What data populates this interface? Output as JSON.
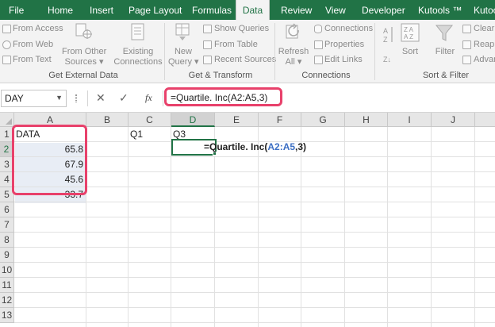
{
  "ribbon_tabs": [
    {
      "label": "File",
      "active": false
    },
    {
      "label": "Home",
      "active": false
    },
    {
      "label": "Insert",
      "active": false
    },
    {
      "label": "Page Layout",
      "active": false
    },
    {
      "label": "Formulas",
      "active": false
    },
    {
      "label": "Data",
      "active": true
    },
    {
      "label": "Review",
      "active": false
    },
    {
      "label": "View",
      "active": false
    },
    {
      "label": "Developer",
      "active": false
    },
    {
      "label": "Kutools ™",
      "active": false
    },
    {
      "label": "Kutoo",
      "active": false
    }
  ],
  "ribbon": {
    "get_external_data": {
      "from_access": "From Access",
      "from_web": "From Web",
      "from_text": "From Text",
      "from_other_sources_line1": "From Other",
      "from_other_sources_line2": "Sources ▾",
      "existing_connections_line1": "Existing",
      "existing_connections_line2": "Connections",
      "group_label": "Get External Data"
    },
    "get_transform": {
      "new_query_line1": "New",
      "new_query_line2": "Query ▾",
      "show_queries": "Show Queries",
      "from_table": "From Table",
      "recent_sources": "Recent Sources",
      "group_label": "Get & Transform"
    },
    "connections": {
      "refresh_all_line1": "Refresh",
      "refresh_all_line2": "All ▾",
      "connections": "Connections",
      "properties": "Properties",
      "edit_links": "Edit Links",
      "group_label": "Connections"
    },
    "sort_filter": {
      "sort": "Sort",
      "filter": "Filter",
      "clear": "Clear",
      "reapply": "Reapp",
      "advanced": "Advan",
      "group_label": "Sort & Filter"
    }
  },
  "formula_bar": {
    "name_box": "DAY",
    "cancel_symbol": "✕",
    "enter_symbol": "✓",
    "fx_label": "fx",
    "formula": "=Quartile. Inc(A2:A5,3)"
  },
  "columns": [
    "A",
    "B",
    "C",
    "D",
    "E",
    "F",
    "G",
    "H",
    "I",
    "J"
  ],
  "rows": [
    "1",
    "2",
    "3",
    "4",
    "5",
    "6",
    "7",
    "8",
    "9",
    "10",
    "11",
    "12",
    "13"
  ],
  "cells": {
    "A1": "DATA",
    "A2": "65.8",
    "A3": "67.9",
    "A4": "45.6",
    "A5": "33.7",
    "C1": "Q1",
    "D1": "Q3"
  },
  "active_cell_edit": {
    "prefix": "=Quartile. Inc(",
    "ref": "A2:A5",
    "suffix": ",3)"
  },
  "colors": {
    "excel_green": "#217346",
    "highlight": "#e8416b",
    "range_reference": "#3c6fc4"
  }
}
